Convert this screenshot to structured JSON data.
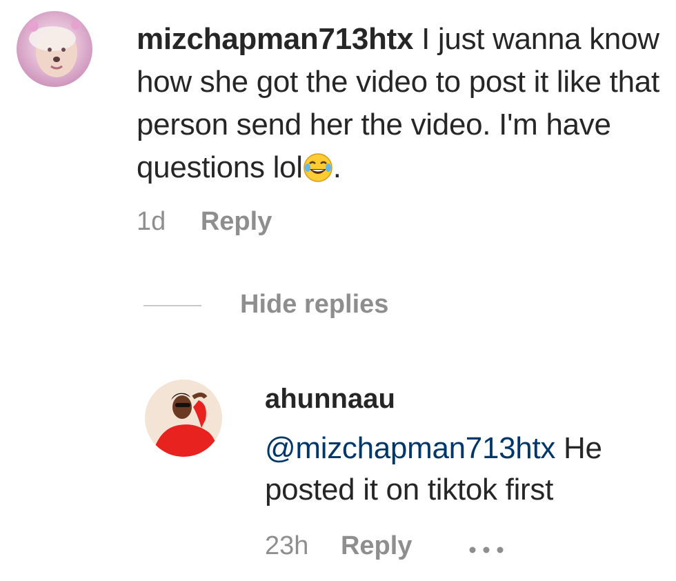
{
  "comment": {
    "username": "mizchapman713htx",
    "text": "I just wanna know how she got the video to post it like that person send her the video. I'm have questions lol",
    "emoji": "face-with-tears-of-joy",
    "trailing": ".",
    "time": "1d",
    "reply_label": "Reply"
  },
  "thread": {
    "hide_replies_label": "Hide replies"
  },
  "reply": {
    "username": "ahunnaau",
    "mention": "@mizchapman713htx",
    "text": "He posted it on tiktok first",
    "time": "23h",
    "reply_label": "Reply",
    "more_icon": "more-horizontal-icon"
  },
  "colors": {
    "text": "#262626",
    "secondary": "#8e8e8e",
    "mention": "#00376b"
  }
}
